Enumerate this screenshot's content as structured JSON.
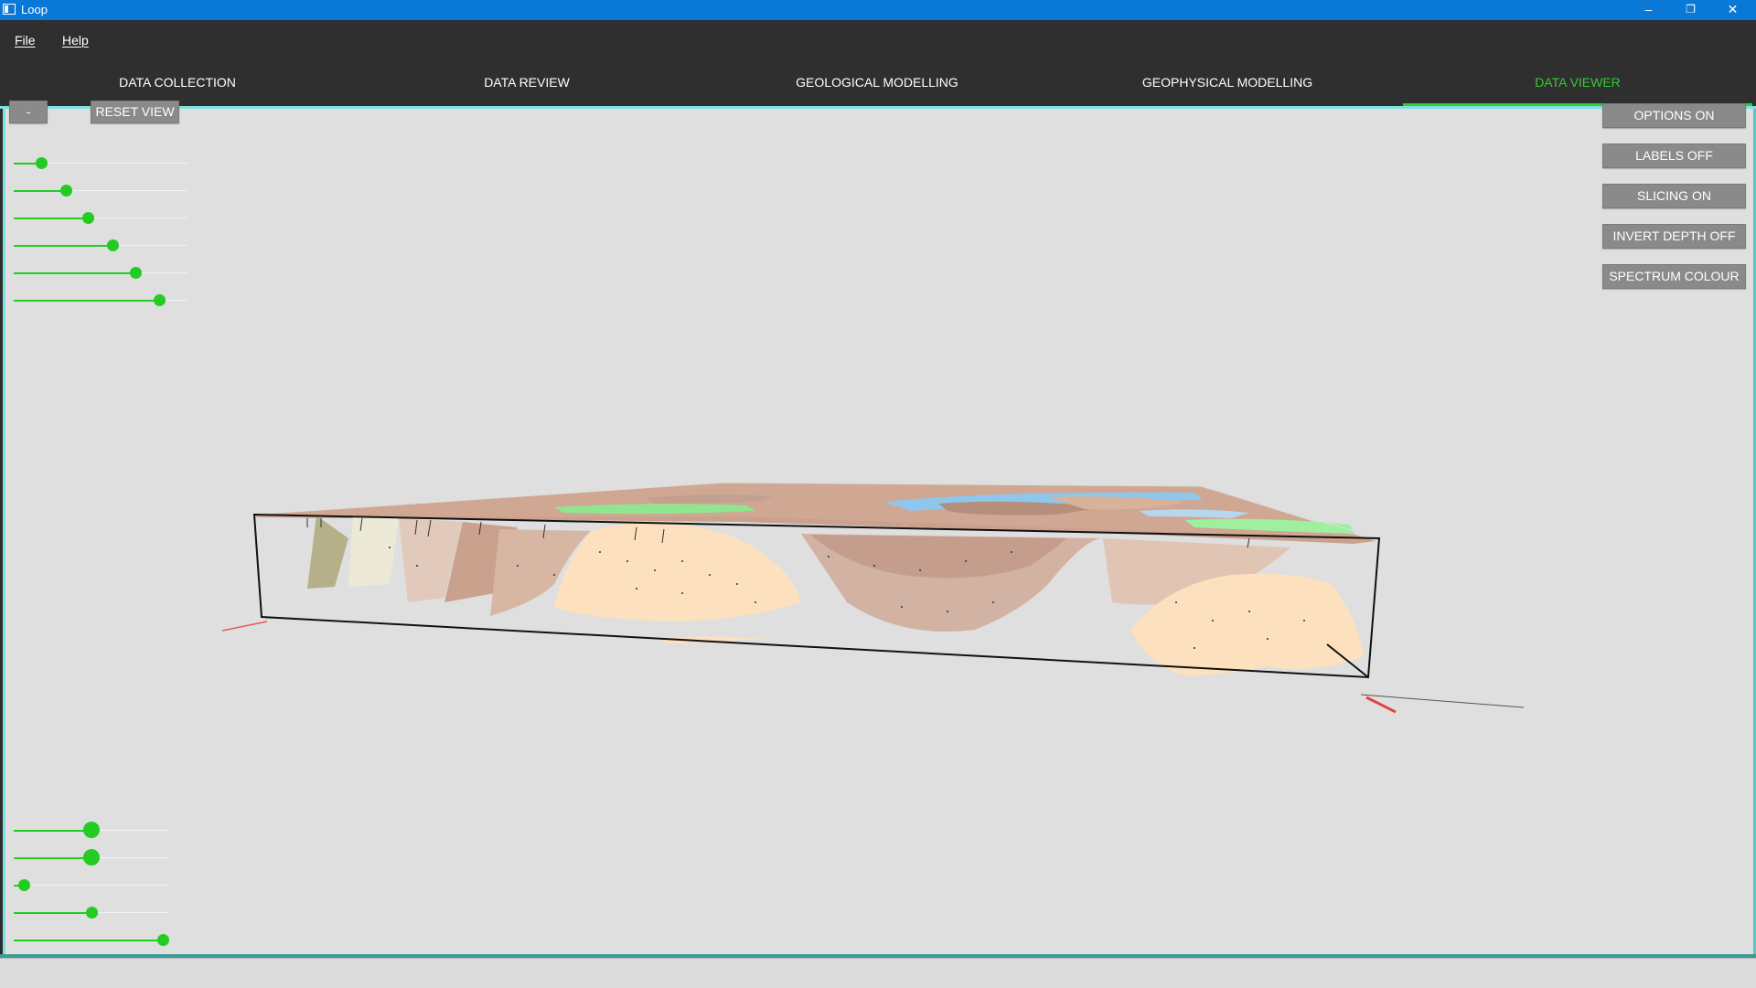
{
  "window": {
    "title": "Loop",
    "minimize": "–",
    "restore": "❐",
    "close": "✕"
  },
  "menu": {
    "file": "File",
    "help": "Help"
  },
  "tabs": [
    {
      "label": "DATA COLLECTION",
      "active": false
    },
    {
      "label": "DATA REVIEW",
      "active": false
    },
    {
      "label": "GEOLOGICAL MODELLING",
      "active": false
    },
    {
      "label": "GEOPHYSICAL MODELLING",
      "active": false
    },
    {
      "label": "DATA VIEWER",
      "active": true
    }
  ],
  "viewer": {
    "collapse_label": "-",
    "reset_label": "RESET VIEW",
    "options": [
      "OPTIONS ON",
      "LABELS OFF",
      "SLICING ON",
      "INVERT DEPTH OFF",
      "SPECTRUM COLOUR"
    ],
    "top_sliders": [
      0.16,
      0.3,
      0.43,
      0.57,
      0.7,
      0.84
    ],
    "bottom_sliders": [
      0.5,
      0.5,
      0.07,
      0.5,
      0.96
    ]
  },
  "colors": {
    "accent": "#22cc22",
    "titlebar": "#0a78d7",
    "background": "#dfdfdf"
  }
}
